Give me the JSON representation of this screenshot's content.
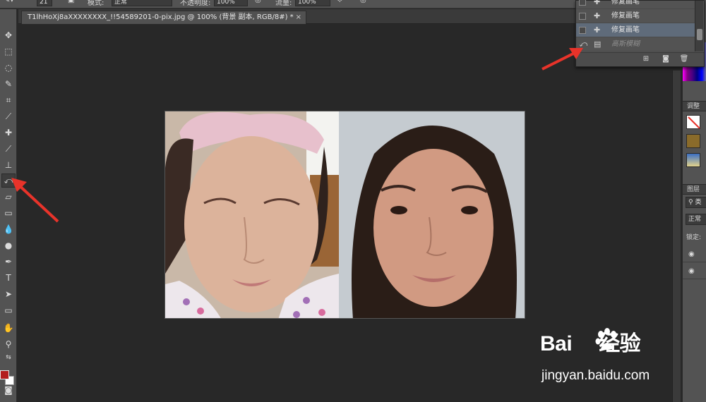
{
  "options_bar": {
    "brush_size": "21",
    "mode_label": "模式:",
    "mode_value": "正常",
    "opacity_label": "不透明度:",
    "opacity_value": "100%",
    "flow_label": "流量:",
    "flow_value": "100%"
  },
  "document": {
    "tab_title": "T1lhHoXj8aXXXXXXXX_!!54589201-0-pix.jpg @ 100% (背景 副本, RGB/8#) *",
    "close_glyph": "×"
  },
  "history": {
    "items": [
      {
        "label": "修复画笔",
        "selected": false,
        "dimmed": false
      },
      {
        "label": "修复画笔",
        "selected": false,
        "dimmed": false
      },
      {
        "label": "修复画笔",
        "selected": true,
        "dimmed": false
      },
      {
        "label": "高斯模糊",
        "selected": false,
        "dimmed": true
      }
    ]
  },
  "right_panel": {
    "adjustments_title": "调整",
    "layers_title": "图层",
    "kind_filter": "类",
    "blend_mode": "正常",
    "lock_label": "锁定:"
  },
  "toolbar": {
    "tools": [
      "move-tool-icon",
      "marquee-tool-icon",
      "lasso-tool-icon",
      "quick-select-tool-icon",
      "crop-tool-icon",
      "eyedropper-tool-icon",
      "healing-brush-tool-icon",
      "brush-tool-icon",
      "clone-stamp-tool-icon",
      "history-brush-tool-icon",
      "eraser-tool-icon",
      "gradient-tool-icon",
      "blur-tool-icon",
      "dodge-tool-icon",
      "pen-tool-icon",
      "type-tool-icon",
      "path-select-tool-icon",
      "shape-tool-icon",
      "hand-tool-icon",
      "zoom-tool-icon"
    ],
    "active_tool": "history-brush-tool-icon",
    "foreground_color": "#b31d1d",
    "background_color": "#ffffff"
  },
  "watermark": {
    "brand": "Bai",
    "brand_suffix": "经验",
    "url": "jingyan.baidu.com"
  },
  "accent_colors": {
    "arrow": "#e8332a",
    "selection": "#5f6b7a"
  }
}
